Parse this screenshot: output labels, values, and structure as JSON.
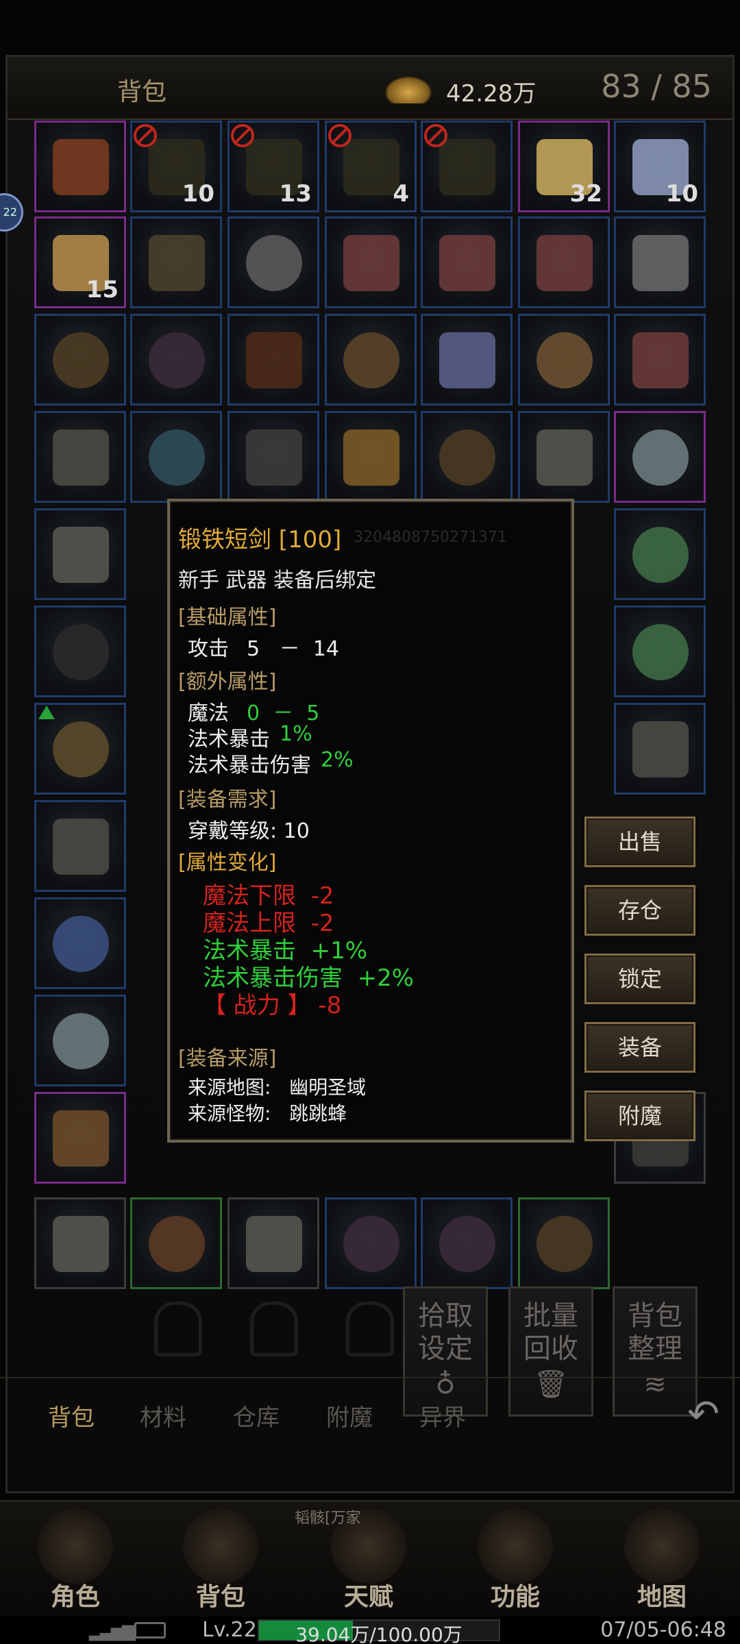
{
  "header": {
    "title": "背包",
    "gold": "42.28万",
    "capacity": "83 / 85"
  },
  "avatar_badge": "22",
  "grid": {
    "counts": [
      "10",
      "13",
      "4",
      "32",
      "10",
      "15"
    ]
  },
  "actions": [
    {
      "label": "拾取\n设定",
      "icon": "pouch-icon"
    },
    {
      "label": "批量\n回收",
      "icon": "trash-icon"
    },
    {
      "label": "背包\n整理",
      "icon": "layers-icon"
    }
  ],
  "tabs": [
    "背包",
    "材料",
    "仓库",
    "附魔",
    "异界"
  ],
  "bottom_nav": [
    "角色",
    "背包",
    "天赋",
    "功能",
    "地图"
  ],
  "bottom_banner": "韬骸[万家",
  "status": {
    "level": "Lv.22",
    "exp": "39.04万/100.00万",
    "exp_fraction": 0.39,
    "time": "07/05-06:48"
  },
  "tooltip": {
    "title": "锻铁短剑 [100]",
    "serial": "3204808750271371",
    "subtitle": "新手 武器 装备后绑定",
    "base_header": "[基础属性]",
    "attack_label": "攻击",
    "attack_value": "5   －  14",
    "extra_header": "[额外属性]",
    "magic_label": "魔法",
    "magic_value": "0  －  5",
    "crit_label": "法术暴击",
    "crit_value": "1%",
    "critdmg_label": "法术暴击伤害",
    "critdmg_value": "2%",
    "req_header": "[装备需求]",
    "req_line": "穿戴等级: 10",
    "change_header": "[属性变化]",
    "changes": [
      {
        "text": "魔法下限  -2",
        "tone": "red"
      },
      {
        "text": "魔法上限  -2",
        "tone": "red"
      },
      {
        "text": "法术暴击  +1%",
        "tone": "green"
      },
      {
        "text": "法术暴击伤害  +2%",
        "tone": "green"
      },
      {
        "text": "【 战力 】 -8",
        "tone": "red"
      }
    ],
    "source_header": "[装备来源]",
    "source_map": "来源地图:   幽明圣域",
    "source_monster": "来源怪物:   跳跳蜂"
  },
  "side_buttons": [
    "出售",
    "存仓",
    "锁定",
    "装备",
    "附魔"
  ],
  "colors": {
    "gold": "#e0a93a",
    "green": "#2fcf3a",
    "red": "#d3231b",
    "slot_blue": "#1f3b6c",
    "slot_purple": "#7b2a8c"
  }
}
